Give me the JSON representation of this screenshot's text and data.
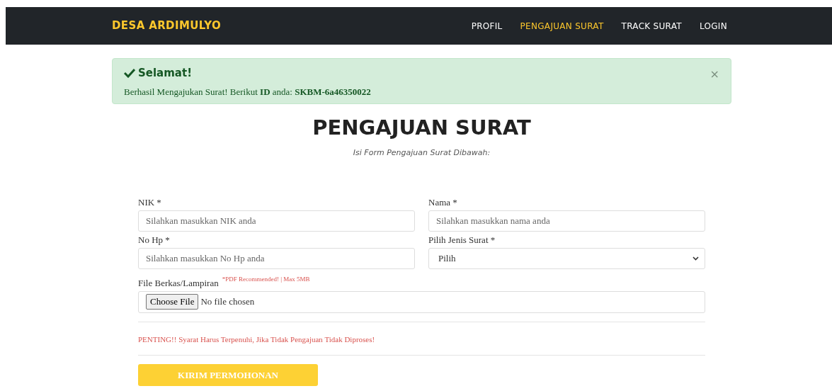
{
  "navbar": {
    "brand": "DESA ARDIMULYO",
    "links": [
      {
        "label": "PROFIL",
        "selected": false
      },
      {
        "label": "PENGAJUAN SURAT",
        "selected": true
      },
      {
        "label": "TRACK SURAT",
        "selected": false
      },
      {
        "label": "LOGIN",
        "selected": false
      }
    ]
  },
  "alert": {
    "title": "Selamat!",
    "message": "Berhasil Mengajukan Surat! Berikut **ID** anda: **SKBM-6a46350022**",
    "close": "×"
  },
  "heading": "PENGAJUAN SURAT",
  "subtitle": "Isi Form Pengajuan Surat Dibawah:",
  "fields": [
    {
      "kind": "text",
      "label": "NIK *",
      "placeholder": "Silahkan masukkan NIK anda"
    },
    {
      "kind": "text",
      "label": "Nama *",
      "placeholder": "Silahkan masukkan nama anda"
    },
    {
      "kind": "text",
      "label": "No Hp *",
      "placeholder": "Silahkan masukkan No Hp anda"
    },
    {
      "kind": "select",
      "label": "Pilih Jenis Surat *",
      "value": "Pilih"
    },
    {
      "kind": "file",
      "label": "File Berkas/Lampiran",
      "note": "*PDF Recommended! | Max 5MB",
      "button": "Choose File",
      "value": "No file chosen"
    }
  ],
  "warning": "PENTING!! Syarat Harus Terpenuhi, Jika Tidak Pengajuan Tidak Diproses!",
  "submit": "KIRIM PERMOHONAN"
}
